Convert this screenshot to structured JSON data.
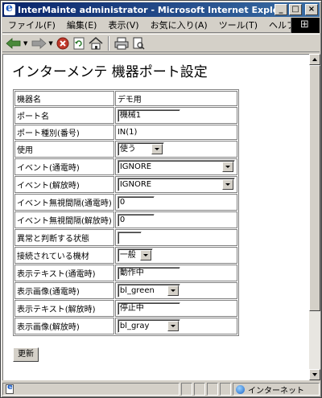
{
  "window": {
    "title": "InterMainte administrator - Microsoft Internet Explorer",
    "controls": {
      "minimize": "_",
      "maximize": "□",
      "close": "×"
    }
  },
  "menu": [
    "ファイル(F)",
    "編集(E)",
    "表示(V)",
    "お気に入り(A)",
    "ツール(T)",
    "ヘルプ("
  ],
  "toolbar": {
    "icons": [
      "back-arrow-icon",
      "forward-arrow-icon",
      "stop-icon",
      "refresh-icon",
      "home-icon",
      "print-icon",
      "print-preview-icon"
    ]
  },
  "page": {
    "title": "インターメンテ 機器ポート設定",
    "rows": [
      {
        "label": "機器名",
        "type": "text",
        "value": "デモ用"
      },
      {
        "label": "ポート名",
        "type": "input",
        "value": "機械1"
      },
      {
        "label": "ポート種別(番号)",
        "type": "text",
        "value": "IN(1)"
      },
      {
        "label": "使用",
        "type": "select",
        "value": "使う"
      },
      {
        "label": "イベント(通電時)",
        "type": "select",
        "value": "IGNORE"
      },
      {
        "label": "イベント(解放時)",
        "type": "select",
        "value": "IGNORE"
      },
      {
        "label": "イベント無視間隔(通電時)",
        "type": "input",
        "value": "0"
      },
      {
        "label": "イベント無視間隔(解放時)",
        "type": "input",
        "value": "0"
      },
      {
        "label": "異常と判断する状態",
        "type": "input",
        "value": ""
      },
      {
        "label": "接続されている機材",
        "type": "select",
        "value": "一般"
      },
      {
        "label": "表示テキスト(通電時)",
        "type": "input",
        "value": "動作中"
      },
      {
        "label": "表示画像(通電時)",
        "type": "select",
        "value": "bl_green"
      },
      {
        "label": "表示テキスト(解放時)",
        "type": "input",
        "value": "停止中"
      },
      {
        "label": "表示画像(解放時)",
        "type": "select",
        "value": "bl_gray"
      }
    ],
    "submit_label": "更新"
  },
  "status": {
    "zone": "インターネット"
  },
  "colors": {
    "titlebar_start": "#0a246a",
    "titlebar_end": "#3a6ea5",
    "chrome": "#d4d0c8"
  }
}
